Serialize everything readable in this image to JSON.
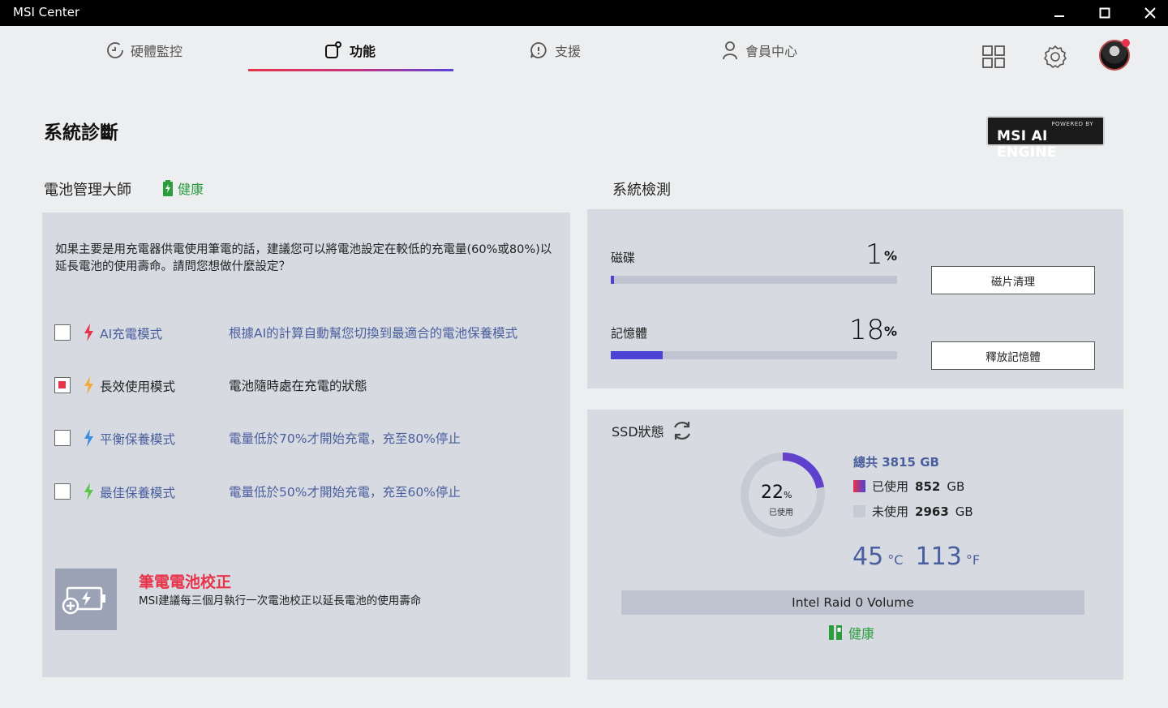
{
  "window": {
    "title": "MSI Center"
  },
  "nav": {
    "tabs": [
      {
        "label": "硬體監控",
        "icon": "hardware-monitor-icon"
      },
      {
        "label": "功能",
        "icon": "features-icon",
        "active": true
      },
      {
        "label": "支援",
        "icon": "support-icon"
      },
      {
        "label": "會員中心",
        "icon": "member-icon"
      }
    ],
    "right_icons": [
      "grid-apps-icon",
      "settings-icon",
      "avatar"
    ]
  },
  "page": {
    "title": "系統診斷",
    "badge_powered": "POWERED BY",
    "badge_engine": "MSI AI ENGINE"
  },
  "battery": {
    "title": "電池管理大師",
    "health": "健康",
    "intro": "如果主要是用充電器供電使用筆電的話，建議您可以將電池設定在較低的充電量(60%或80%)以延長電池的使用壽命。請問您想做什麼設定？",
    "modes": [
      {
        "label": "AI充電模式",
        "desc": "根據AI的計算自動幫您切換到最適合的電池保養模式",
        "checked": false,
        "bolt_color": "#e8334a"
      },
      {
        "label": "長效使用模式",
        "desc": "電池隨時處在充電的狀態",
        "checked": true,
        "bolt_color": "#f2a93b"
      },
      {
        "label": "平衡保養模式",
        "desc": "電量低於70%才開始充電，充至80%停止",
        "checked": false,
        "bolt_color": "#3b8de0"
      },
      {
        "label": "最佳保養模式",
        "desc": "電量低於50%才開始充電，充至60%停止",
        "checked": false,
        "bolt_color": "#5cc44a"
      }
    ],
    "calibration": {
      "title": "筆電電池校正",
      "desc": "MSI建議每三個月執行一次電池校正以延長電池的使用壽命"
    }
  },
  "system_check": {
    "title": "系統檢測",
    "disk": {
      "label": "磁碟",
      "value": "1",
      "unit": "%",
      "fraction": 0.01,
      "button": "磁片清理"
    },
    "memory": {
      "label": "記憶體",
      "value": "18",
      "unit": "%",
      "fraction": 0.18,
      "button": "釋放記憶體"
    }
  },
  "ssd": {
    "title": "SSD狀態",
    "used_percent": "22",
    "used_percent_unit": "%",
    "used_caption": "已使用",
    "used_fraction": 0.22,
    "total_label": "總共",
    "total_value": "3815",
    "total_unit": "GB",
    "used_label": "已使用",
    "used_value": "852",
    "used_unit": "GB",
    "free_label": "未使用",
    "free_value": "2963",
    "free_unit": "GB",
    "temp_c": "45",
    "temp_c_unit": "°C",
    "temp_f": "113",
    "temp_f_unit": "°F",
    "volume": "Intel Raid 0 Volume",
    "health": "健康"
  },
  "colors": {
    "accent_red": "#e8334a",
    "accent_blue": "#4c43d6",
    "health_green": "#2c9d3f",
    "link_blue": "#4a5f9e"
  }
}
